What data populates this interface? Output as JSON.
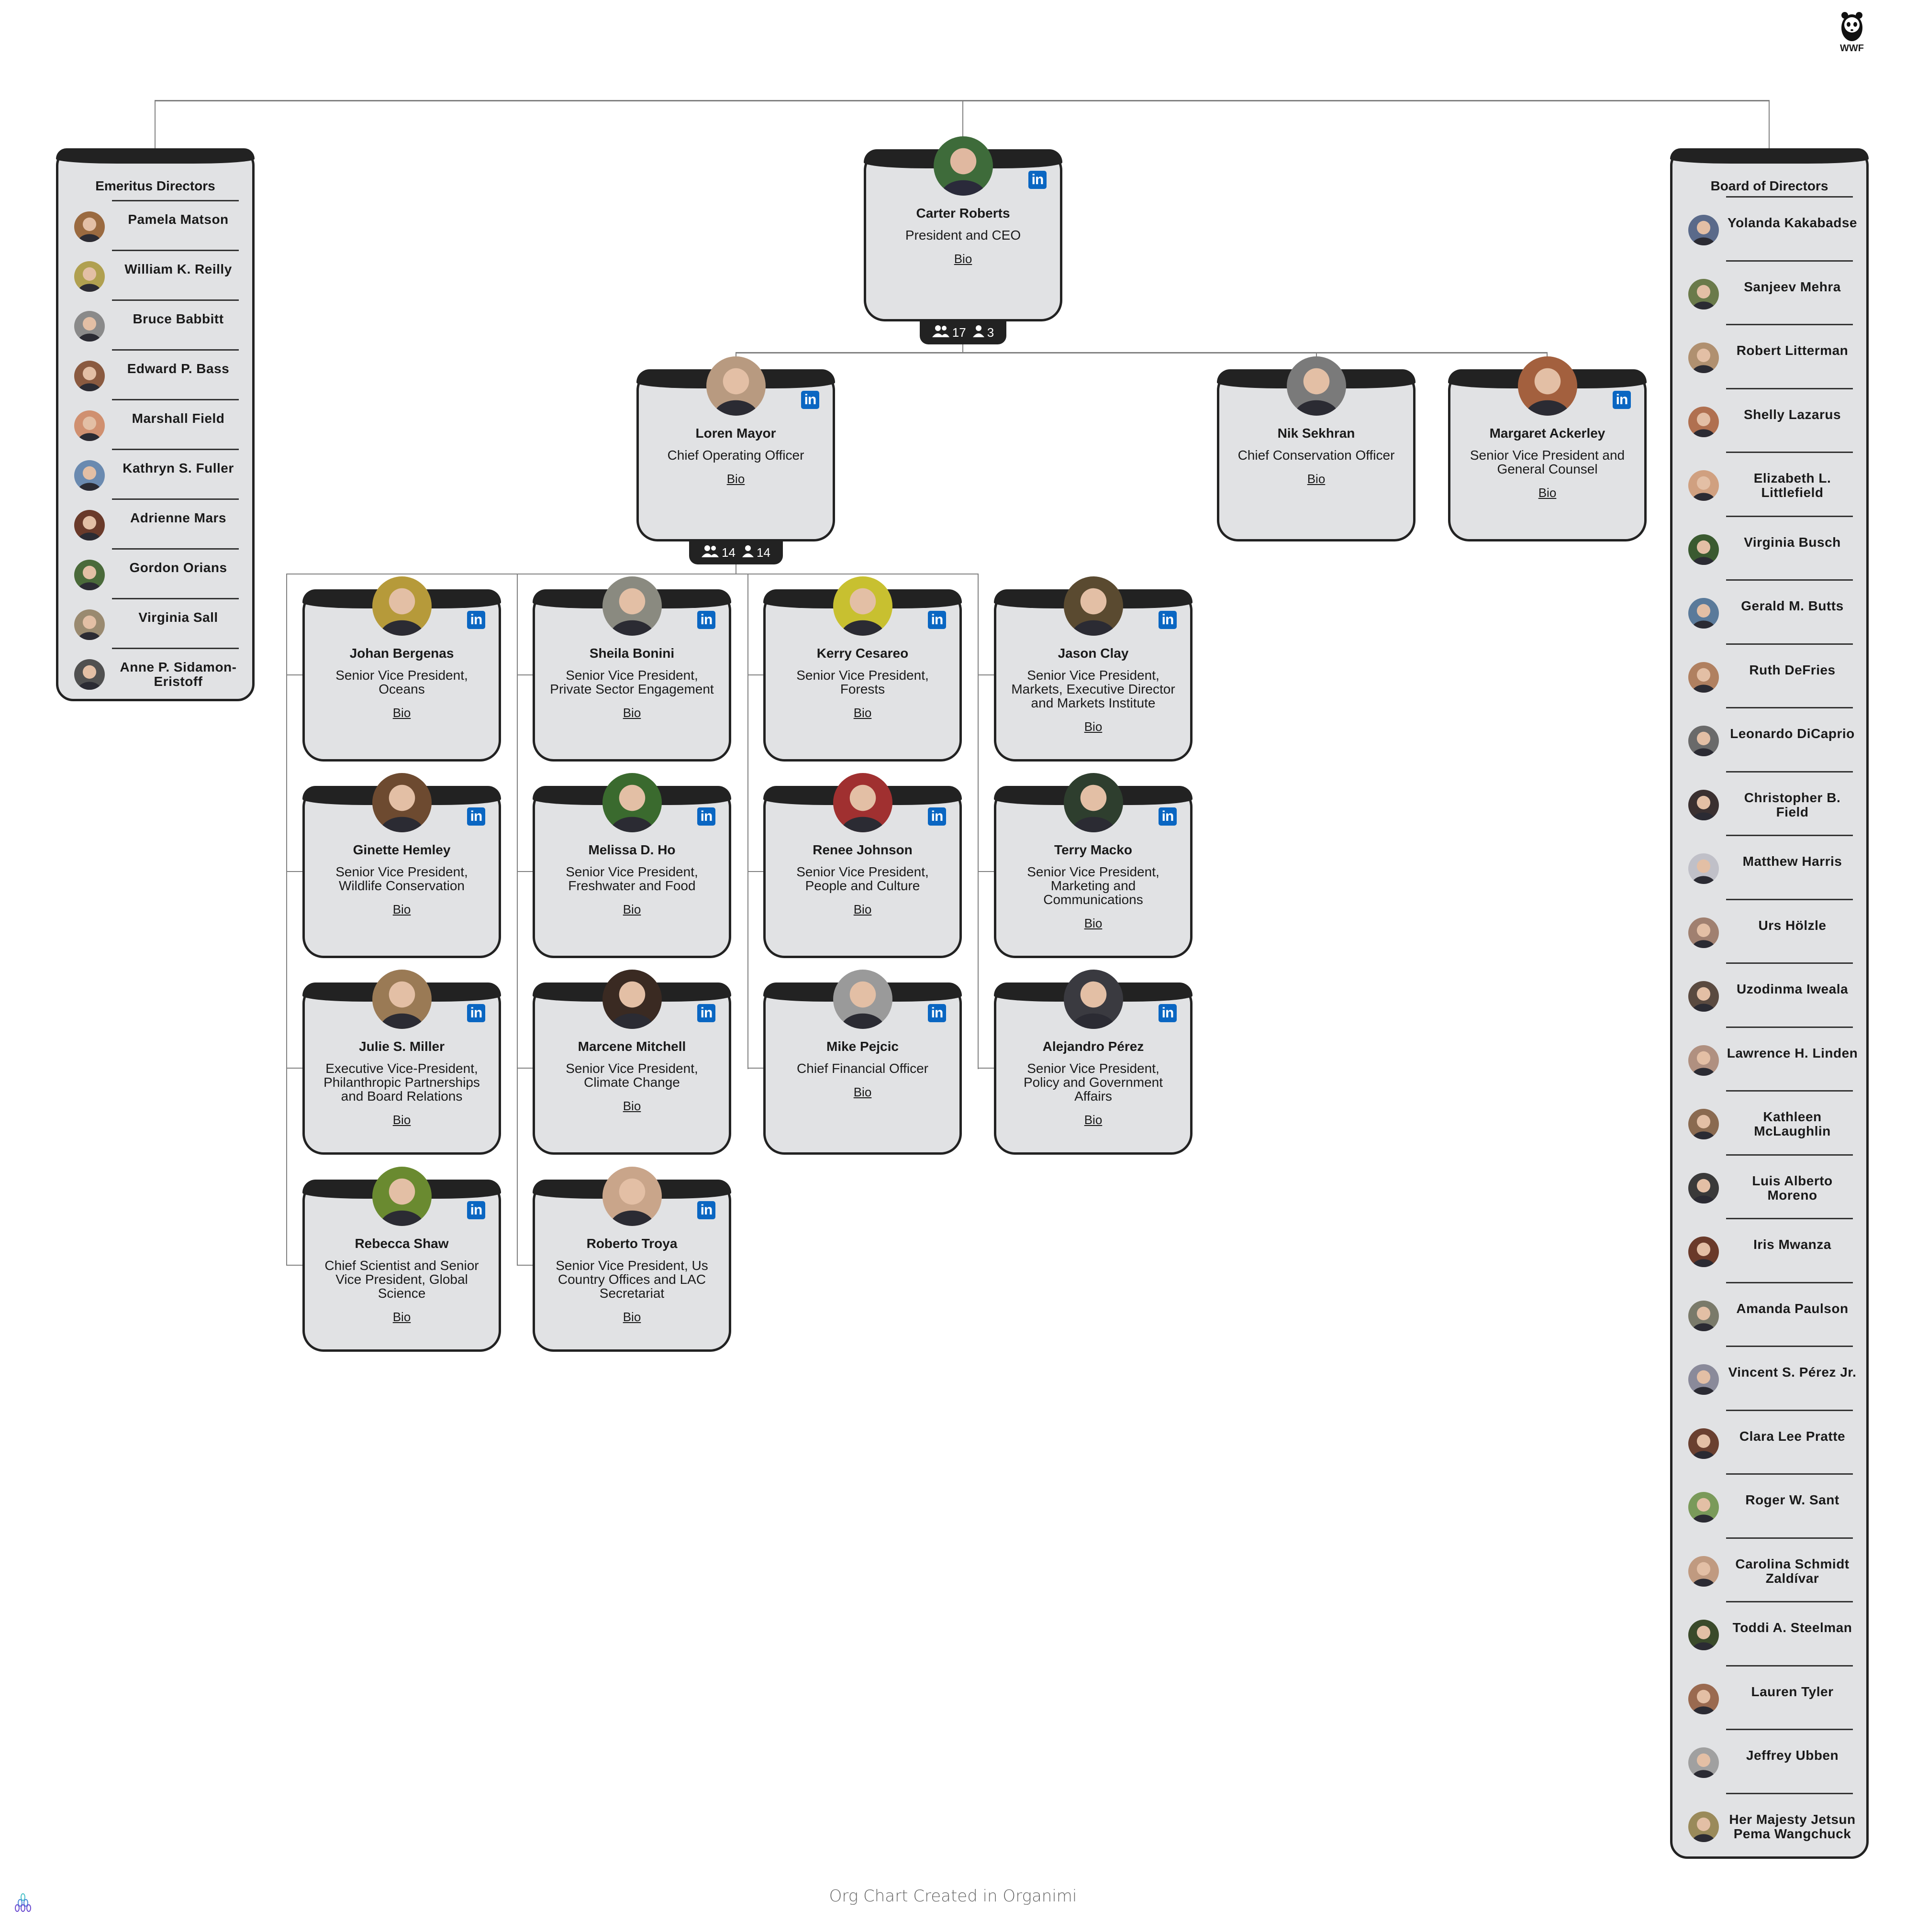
{
  "logo": {
    "text": "WWF"
  },
  "footer": {
    "text": "Org Chart Created in Organimi"
  },
  "ceo": {
    "name": "Carter Roberts",
    "title": "President and CEO",
    "bio": "Bio",
    "linkedin": true,
    "badge": {
      "total": "17",
      "direct": "3"
    },
    "avatar_color": "#3e6b3a"
  },
  "level2": [
    {
      "name": "Loren Mayor",
      "title": "Chief Operating Officer",
      "bio": "Bio",
      "linkedin": true,
      "avatar_color": "#b89a80",
      "badge": {
        "total": "14",
        "direct": "14"
      }
    },
    {
      "name": "Nik Sekhran",
      "title": "Chief Conservation Officer",
      "bio": "Bio",
      "linkedin": false,
      "avatar_color": "#7a7a7a"
    },
    {
      "name": "Margaret Ackerley",
      "title": "Senior Vice President and General Counsel",
      "bio": "Bio",
      "linkedin": true,
      "avatar_color": "#a3603e"
    }
  ],
  "reports": [
    [
      {
        "name": "Johan Bergenas",
        "title": "Senior Vice President, Oceans",
        "bio": "Bio",
        "linkedin": true,
        "avatar_color": "#b69a3a"
      },
      {
        "name": "Ginette Hemley",
        "title": "Senior Vice President, Wildlife Conservation",
        "bio": "Bio",
        "linkedin": true,
        "avatar_color": "#6d4a30"
      },
      {
        "name": "Julie S. Miller",
        "title": "Executive Vice-President, Philanthropic Partnerships and Board Relations",
        "bio": "Bio",
        "linkedin": true,
        "avatar_color": "#9a7a55"
      },
      {
        "name": "Rebecca Shaw",
        "title": "Chief Scientist and Senior Vice President, Global Science",
        "bio": "Bio",
        "linkedin": true,
        "avatar_color": "#6a8a30"
      }
    ],
    [
      {
        "name": "Sheila Bonini",
        "title": "Senior Vice President, Private Sector Engagement",
        "bio": "Bio",
        "linkedin": true,
        "avatar_color": "#8a8a80"
      },
      {
        "name": "Melissa D. Ho",
        "title": "Senior Vice President, Freshwater and Food",
        "bio": "Bio",
        "linkedin": true,
        "avatar_color": "#3a6a2e"
      },
      {
        "name": "Marcene Mitchell",
        "title": "Senior Vice President, Climate Change",
        "bio": "Bio",
        "linkedin": true,
        "avatar_color": "#3a2a22"
      },
      {
        "name": "Roberto Troya",
        "title": "Senior Vice President, Us Country Offices and LAC Secretariat",
        "bio": "Bio",
        "linkedin": true,
        "avatar_color": "#c9a58a"
      }
    ],
    [
      {
        "name": "Kerry Cesareo",
        "title": "Senior Vice President, Forests",
        "bio": "Bio",
        "linkedin": true,
        "avatar_color": "#c8c030"
      },
      {
        "name": "Renee Johnson",
        "title": "Senior Vice President, People and Culture",
        "bio": "Bio",
        "linkedin": true,
        "avatar_color": "#a03030"
      },
      {
        "name": "Mike Pejcic",
        "title": "Chief Financial Officer",
        "bio": "Bio",
        "linkedin": true,
        "avatar_color": "#9a9a9a"
      }
    ],
    [
      {
        "name": "Jason Clay",
        "title": "Senior Vice President, Markets, Executive Director and Markets Institute",
        "bio": "Bio",
        "linkedin": true,
        "avatar_color": "#5a4a30"
      },
      {
        "name": "Terry Macko",
        "title": "Senior Vice President, Marketing and Communications",
        "bio": "Bio",
        "linkedin": true,
        "avatar_color": "#2e3e2e"
      },
      {
        "name": "Alejandro Pérez",
        "title": "Senior Vice President, Policy and Government Affairs",
        "bio": "Bio",
        "linkedin": true,
        "avatar_color": "#3a3a40"
      }
    ]
  ],
  "emeritus": {
    "title": "Emeritus Directors",
    "members": [
      {
        "name": "Pamela Matson",
        "avatar_color": "#9a6a40"
      },
      {
        "name": "William K. Reilly",
        "avatar_color": "#b0a050"
      },
      {
        "name": "Bruce Babbitt",
        "avatar_color": "#8a8a8a"
      },
      {
        "name": "Edward P. Bass",
        "avatar_color": "#8a5a40"
      },
      {
        "name": "Marshall Field",
        "avatar_color": "#d09070"
      },
      {
        "name": "Kathryn S. Fuller",
        "avatar_color": "#6a8ab0"
      },
      {
        "name": "Adrienne Mars",
        "avatar_color": "#6a3a2a"
      },
      {
        "name": "Gordon Orians",
        "avatar_color": "#4a6a3a"
      },
      {
        "name": "Virginia Sall",
        "avatar_color": "#9a8a70"
      },
      {
        "name": "Anne P. Sidamon-Eristoff",
        "avatar_color": "#505050"
      }
    ]
  },
  "board": {
    "title": "Board of Directors",
    "members": [
      {
        "name": "Yolanda Kakabadse",
        "avatar_color": "#5a6a8a"
      },
      {
        "name": "Sanjeev Mehra",
        "avatar_color": "#6a7a4a"
      },
      {
        "name": "Robert Litterman",
        "avatar_color": "#b09070"
      },
      {
        "name": "Shelly Lazarus",
        "avatar_color": "#b07050"
      },
      {
        "name": "Elizabeth L. Littlefield",
        "avatar_color": "#d0a080"
      },
      {
        "name": "Virginia Busch",
        "avatar_color": "#3a5a30"
      },
      {
        "name": "Gerald M. Butts",
        "avatar_color": "#5a7a9a"
      },
      {
        "name": "Ruth DeFries",
        "avatar_color": "#b08060"
      },
      {
        "name": "Leonardo DiCaprio",
        "avatar_color": "#6a6a6a"
      },
      {
        "name": "Christopher B. Field",
        "avatar_color": "#3a3030"
      },
      {
        "name": "Matthew Harris",
        "avatar_color": "#c0c0c8"
      },
      {
        "name": "Urs Hölzle",
        "avatar_color": "#a08070"
      },
      {
        "name": "Uzodinma Iweala",
        "avatar_color": "#5a4a40"
      },
      {
        "name": "Lawrence H. Linden",
        "avatar_color": "#b09080"
      },
      {
        "name": "Kathleen McLaughlin",
        "avatar_color": "#8a6a50"
      },
      {
        "name": "Luis Alberto Moreno",
        "avatar_color": "#3a3a3a"
      },
      {
        "name": "Iris Mwanza",
        "avatar_color": "#6a3a2a"
      },
      {
        "name": "Amanda Paulson",
        "avatar_color": "#7a7a6a"
      },
      {
        "name": "Vincent S. Pérez Jr.",
        "avatar_color": "#8a8a9a"
      },
      {
        "name": "Clara Lee Pratte",
        "avatar_color": "#6a4030"
      },
      {
        "name": "Roger W. Sant",
        "avatar_color": "#7a9a5a"
      },
      {
        "name": "Carolina Schmidt Zaldívar",
        "avatar_color": "#c09a80"
      },
      {
        "name": "Toddi A. Steelman",
        "avatar_color": "#3a4a2a"
      },
      {
        "name": "Lauren Tyler",
        "avatar_color": "#9a6a50"
      },
      {
        "name": "Jeffrey Ubben",
        "avatar_color": "#a0a0a0"
      },
      {
        "name": "Her Majesty Jetsun Pema Wangchuck",
        "avatar_color": "#9a8a5a"
      }
    ]
  },
  "colors": {
    "card_bg": "#e1e2e4",
    "card_header": "#222222",
    "linkedin": "#0a66c2",
    "connector": "#808080"
  }
}
